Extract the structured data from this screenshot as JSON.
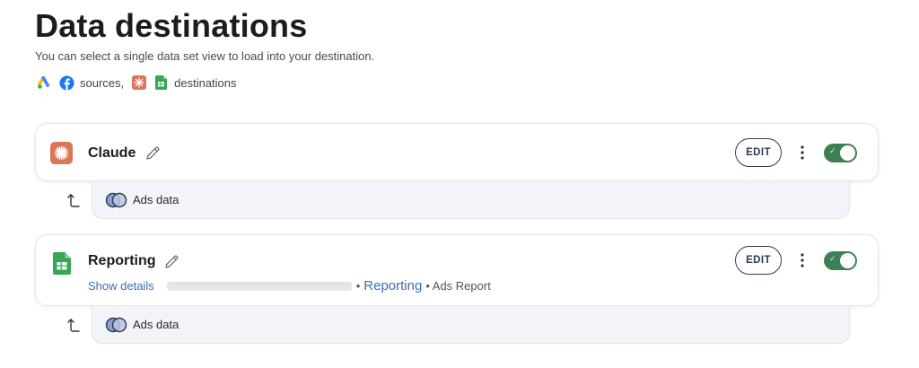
{
  "header": {
    "title": "Data destinations",
    "subtitle": "You can select a single data set view to load into your destination.",
    "sources_label": "sources,",
    "destinations_label": "destinations",
    "source_icons": [
      "google-ads-icon",
      "facebook-icon"
    ],
    "destination_icons": [
      "claude-icon",
      "google-sheets-icon"
    ]
  },
  "destinations": [
    {
      "name": "Claude",
      "logo": "claude-icon",
      "edit_label": "EDIT",
      "enabled": true,
      "dataset": {
        "label": "Ads data",
        "icon": "dataset-icon"
      }
    },
    {
      "name": "Reporting",
      "logo": "google-sheets-icon",
      "edit_label": "EDIT",
      "enabled": true,
      "show_details": "Show details",
      "separator": "•",
      "spreadsheet": "Reporting",
      "sheet": "• Ads Report",
      "dataset": {
        "label": "Ads data",
        "icon": "dataset-icon"
      }
    }
  ],
  "colors": {
    "toggle_on": "#3e7f53",
    "link": "#3b6db3",
    "claude_brand": "#d97757",
    "sheets_brand": "#34a853"
  }
}
